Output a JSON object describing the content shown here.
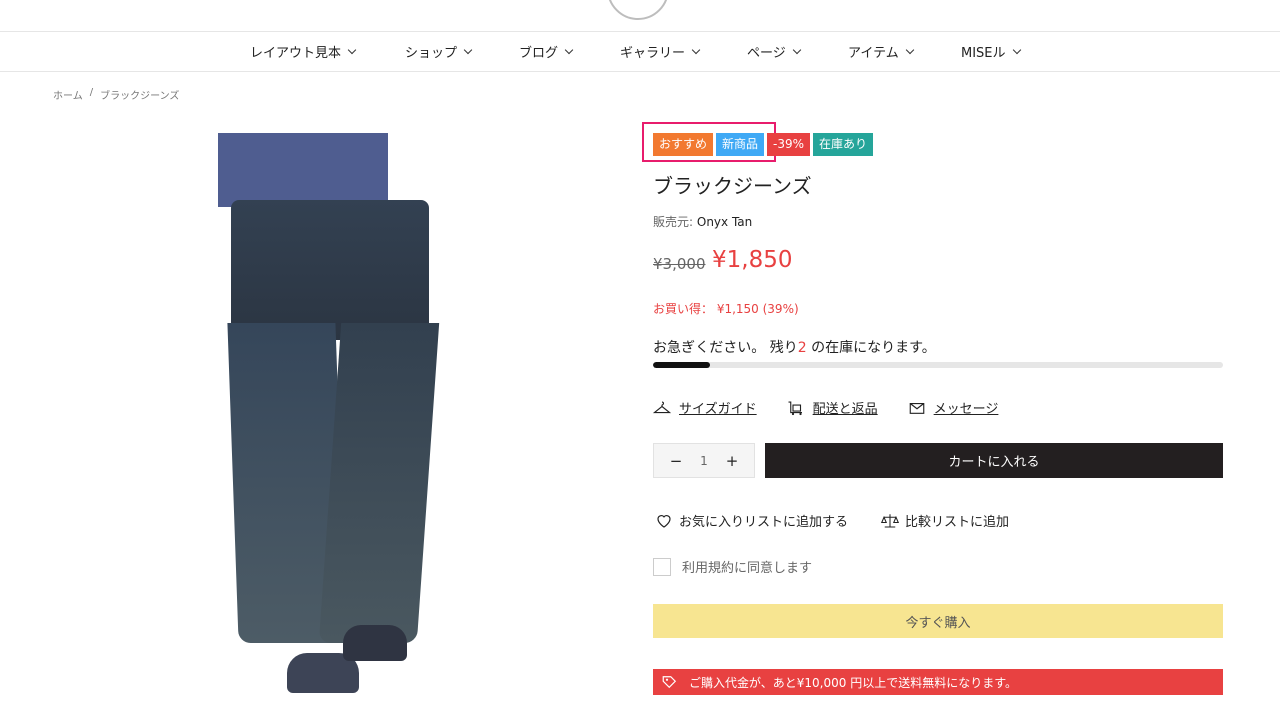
{
  "nav": {
    "items": [
      {
        "label": "レイアウト見本"
      },
      {
        "label": "ショップ"
      },
      {
        "label": "ブログ"
      },
      {
        "label": "ギャラリー"
      },
      {
        "label": "ページ"
      },
      {
        "label": "アイテム"
      },
      {
        "label": "MISEル"
      }
    ]
  },
  "breadcrumb": {
    "home": "ホーム",
    "separator": "/",
    "current": "ブラックジーンズ"
  },
  "product": {
    "badges": {
      "recommended": "おすすめ",
      "new": "新商品",
      "discount": "-39%",
      "stock": "在庫あり"
    },
    "title": "ブラックジーンズ",
    "vendor_label": "販売元:",
    "vendor": "Onyx Tan",
    "price_old": "¥3,000",
    "price_new": "¥1,850",
    "savings": "お買い得： ¥1,150 (39%)",
    "hurry_prefix": "お急ぎください。 残り",
    "hurry_count": "2",
    "hurry_suffix": " の在庫になります。",
    "stock_level": 0.1,
    "quantity": "1",
    "qty_minus": "−",
    "qty_plus": "+"
  },
  "links": {
    "size_guide": "サイズガイド",
    "shipping_returns": "配送と返品",
    "message": "メッセージ"
  },
  "buttons": {
    "add_to_cart": "カートに入れる",
    "wishlist": "お気に入りリストに追加する",
    "compare": "比較リストに追加",
    "buy_now": "今すぐ購入"
  },
  "terms": {
    "label": "利用規約に同意します"
  },
  "shipping_notice": "ご購入代金が、あと¥10,000 円以上で送料無料になります。",
  "colors": {
    "accent_red": "#e84141",
    "badge_orange": "#f27930",
    "badge_blue": "#3fa9f5",
    "badge_teal": "#25a59a",
    "cart_button": "#231f20",
    "buy_now": "#f7e591",
    "highlight_box": "#e81c6c"
  }
}
